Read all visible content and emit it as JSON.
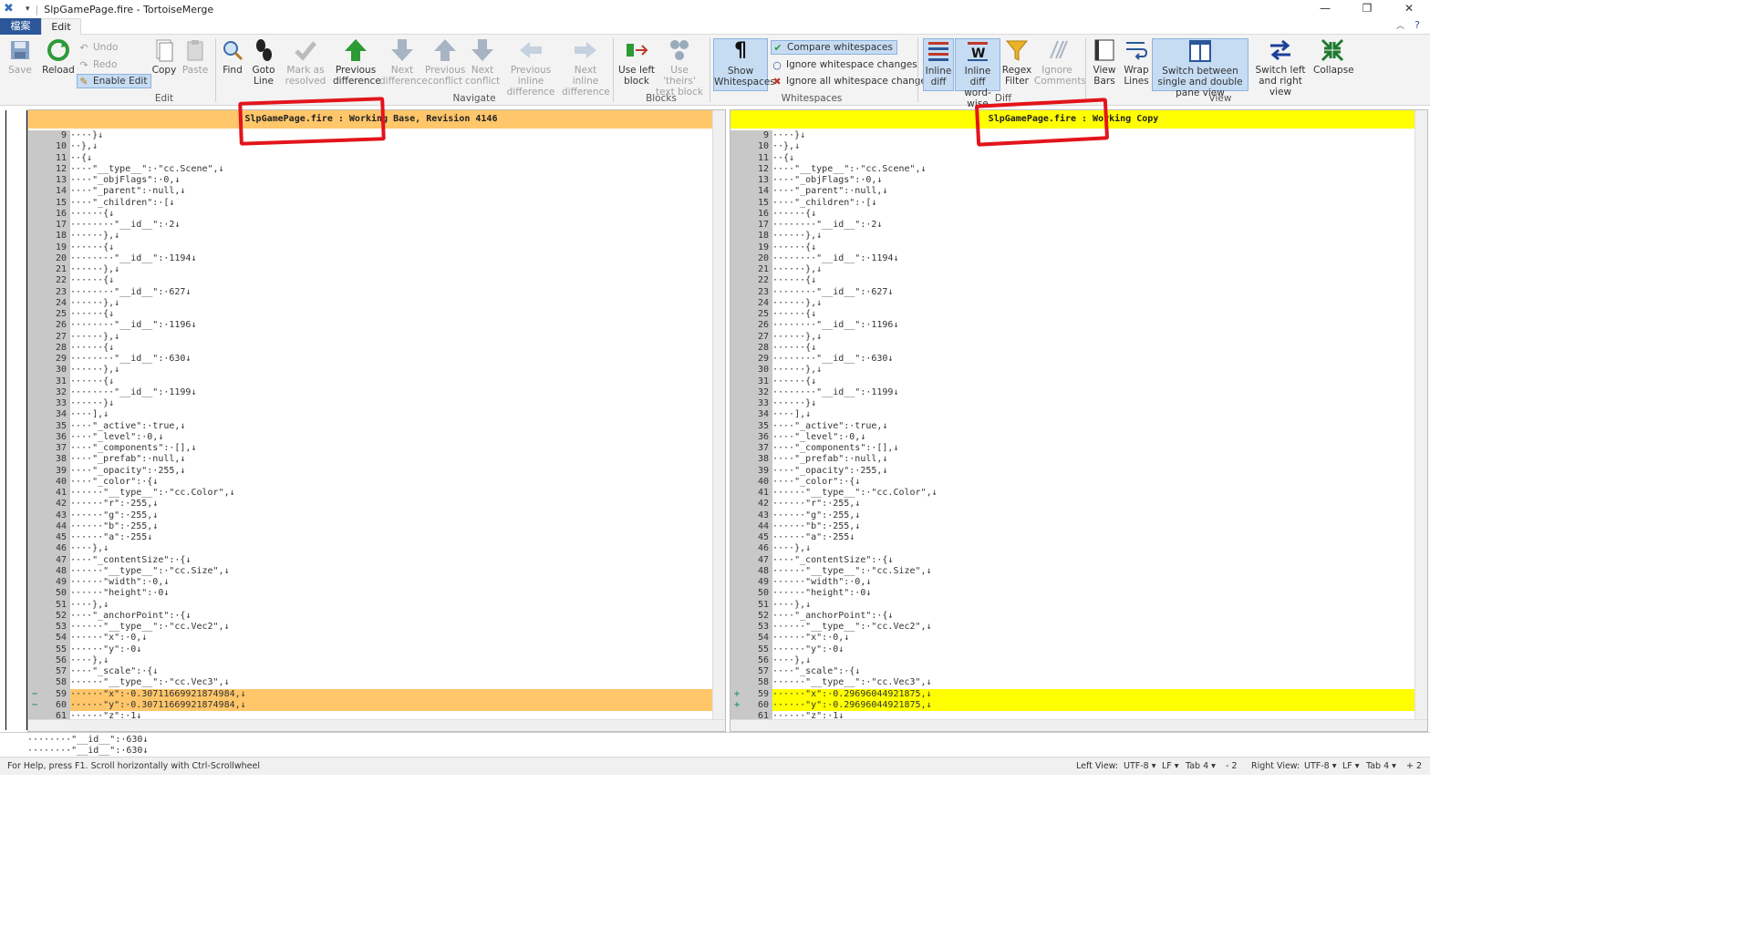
{
  "window": {
    "title": "SlpGamePage.fire - TortoiseMerge",
    "min": "—",
    "max": "❐",
    "close": "✕"
  },
  "tabs": {
    "file": "檔案",
    "edit": "Edit"
  },
  "ribbon": {
    "save": "Save",
    "reload": "Reload",
    "undo": "Undo",
    "redo": "Redo",
    "enable_edit": "Enable Edit",
    "copy": "Copy",
    "paste": "Paste",
    "find": "Find",
    "goto_line": "Goto Line",
    "mark_resolved": "Mark as resolved",
    "prev_diff": "Previous difference",
    "next_diff": "Next difference",
    "prev_conflict": "Previous conflict",
    "next_conflict": "Next conflict",
    "prev_inline": "Previous inline difference",
    "next_inline": "Next inline difference",
    "use_left": "Use left block",
    "use_theirs": "Use 'theirs' text block",
    "show_ws": "Show Whitespaces",
    "compare_ws": "Compare whitespaces",
    "ignore_ws_changes": "Ignore whitespace changes",
    "ignore_all_ws": "Ignore all whitespace changes",
    "inline_diff": "Inline diff",
    "inline_word": "Inline diff word-wise",
    "regex_filter": "Regex Filter",
    "ignore_comments": "Ignore Comments",
    "view_bars": "View Bars",
    "wrap_lines": "Wrap Lines",
    "switch_single_double": "Switch between single and double pane view",
    "switch_left_right": "Switch left and right view",
    "collapse": "Collapse",
    "groups": {
      "edit": "Edit",
      "navigate": "Navigate",
      "blocks": "Blocks",
      "whitespaces": "Whitespaces",
      "diff": "Diff",
      "view": "View"
    }
  },
  "left_pane": {
    "header": "SlpGamePage.fire : Working Base, Revision 4146",
    "header_color": "#ffc66a",
    "changed_color": "#ffc66a",
    "lines": [
      {
        "n": "9",
        "t": "····}↓"
      },
      {
        "n": "10",
        "t": "··},↓"
      },
      {
        "n": "11",
        "t": "··{↓"
      },
      {
        "n": "12",
        "t": "····\"__type__\":·\"cc.Scene\",↓"
      },
      {
        "n": "13",
        "t": "····\"_objFlags\":·0,↓"
      },
      {
        "n": "14",
        "t": "····\"_parent\":·null,↓"
      },
      {
        "n": "15",
        "t": "····\"_children\":·[↓"
      },
      {
        "n": "16",
        "t": "······{↓"
      },
      {
        "n": "17",
        "t": "········\"__id__\":·2↓"
      },
      {
        "n": "18",
        "t": "······},↓"
      },
      {
        "n": "19",
        "t": "······{↓"
      },
      {
        "n": "20",
        "t": "········\"__id__\":·1194↓"
      },
      {
        "n": "21",
        "t": "······},↓"
      },
      {
        "n": "22",
        "t": "······{↓"
      },
      {
        "n": "23",
        "t": "········\"__id__\":·627↓"
      },
      {
        "n": "24",
        "t": "······},↓"
      },
      {
        "n": "25",
        "t": "······{↓"
      },
      {
        "n": "26",
        "t": "········\"__id__\":·1196↓"
      },
      {
        "n": "27",
        "t": "······},↓"
      },
      {
        "n": "28",
        "t": "······{↓"
      },
      {
        "n": "29",
        "t": "········\"__id__\":·630↓"
      },
      {
        "n": "30",
        "t": "······},↓"
      },
      {
        "n": "31",
        "t": "······{↓"
      },
      {
        "n": "32",
        "t": "········\"__id__\":·1199↓"
      },
      {
        "n": "33",
        "t": "······}↓"
      },
      {
        "n": "34",
        "t": "····],↓"
      },
      {
        "n": "35",
        "t": "····\"_active\":·true,↓"
      },
      {
        "n": "36",
        "t": "····\"_level\":·0,↓"
      },
      {
        "n": "37",
        "t": "····\"_components\":·[],↓"
      },
      {
        "n": "38",
        "t": "····\"_prefab\":·null,↓"
      },
      {
        "n": "39",
        "t": "····\"_opacity\":·255,↓"
      },
      {
        "n": "40",
        "t": "····\"_color\":·{↓"
      },
      {
        "n": "41",
        "t": "······\"__type__\":·\"cc.Color\",↓"
      },
      {
        "n": "42",
        "t": "······\"r\":·255,↓"
      },
      {
        "n": "43",
        "t": "······\"g\":·255,↓"
      },
      {
        "n": "44",
        "t": "······\"b\":·255,↓"
      },
      {
        "n": "45",
        "t": "······\"a\":·255↓"
      },
      {
        "n": "46",
        "t": "····},↓"
      },
      {
        "n": "47",
        "t": "····\"_contentSize\":·{↓"
      },
      {
        "n": "48",
        "t": "······\"__type__\":·\"cc.Size\",↓"
      },
      {
        "n": "49",
        "t": "······\"width\":·0,↓"
      },
      {
        "n": "50",
        "t": "······\"height\":·0↓"
      },
      {
        "n": "51",
        "t": "····},↓"
      },
      {
        "n": "52",
        "t": "····\"_anchorPoint\":·{↓"
      },
      {
        "n": "53",
        "t": "······\"__type__\":·\"cc.Vec2\",↓"
      },
      {
        "n": "54",
        "t": "······\"x\":·0,↓"
      },
      {
        "n": "55",
        "t": "······\"y\":·0↓"
      },
      {
        "n": "56",
        "t": "····},↓"
      },
      {
        "n": "57",
        "t": "····\"_scale\":·{↓"
      },
      {
        "n": "58",
        "t": "······\"__type__\":·\"cc.Vec3\",↓"
      },
      {
        "n": "59",
        "t": "······\"x\":·0.30711669921874984,↓",
        "changed": true,
        "mark": "−"
      },
      {
        "n": "60",
        "t": "······\"y\":·0.30711669921874984,↓",
        "changed": true,
        "mark": "−"
      },
      {
        "n": "61",
        "t": "······\"z\":·1↓"
      }
    ]
  },
  "right_pane": {
    "header": "SlpGamePage.fire : Working Copy",
    "header_color": "#ffff00",
    "changed_color": "#ffff00",
    "lines": [
      {
        "n": "9",
        "t": "····}↓"
      },
      {
        "n": "10",
        "t": "··},↓"
      },
      {
        "n": "11",
        "t": "··{↓"
      },
      {
        "n": "12",
        "t": "····\"__type__\":·\"cc.Scene\",↓"
      },
      {
        "n": "13",
        "t": "····\"_objFlags\":·0,↓"
      },
      {
        "n": "14",
        "t": "····\"_parent\":·null,↓"
      },
      {
        "n": "15",
        "t": "····\"_children\":·[↓"
      },
      {
        "n": "16",
        "t": "······{↓"
      },
      {
        "n": "17",
        "t": "········\"__id__\":·2↓"
      },
      {
        "n": "18",
        "t": "······},↓"
      },
      {
        "n": "19",
        "t": "······{↓"
      },
      {
        "n": "20",
        "t": "········\"__id__\":·1194↓"
      },
      {
        "n": "21",
        "t": "······},↓"
      },
      {
        "n": "22",
        "t": "······{↓"
      },
      {
        "n": "23",
        "t": "········\"__id__\":·627↓"
      },
      {
        "n": "24",
        "t": "······},↓"
      },
      {
        "n": "25",
        "t": "······{↓"
      },
      {
        "n": "26",
        "t": "········\"__id__\":·1196↓"
      },
      {
        "n": "27",
        "t": "······},↓"
      },
      {
        "n": "28",
        "t": "······{↓"
      },
      {
        "n": "29",
        "t": "········\"__id__\":·630↓"
      },
      {
        "n": "30",
        "t": "······},↓"
      },
      {
        "n": "31",
        "t": "······{↓"
      },
      {
        "n": "32",
        "t": "········\"__id__\":·1199↓"
      },
      {
        "n": "33",
        "t": "······}↓"
      },
      {
        "n": "34",
        "t": "····],↓"
      },
      {
        "n": "35",
        "t": "····\"_active\":·true,↓"
      },
      {
        "n": "36",
        "t": "····\"_level\":·0,↓"
      },
      {
        "n": "37",
        "t": "····\"_components\":·[],↓"
      },
      {
        "n": "38",
        "t": "····\"_prefab\":·null,↓"
      },
      {
        "n": "39",
        "t": "····\"_opacity\":·255,↓"
      },
      {
        "n": "40",
        "t": "····\"_color\":·{↓"
      },
      {
        "n": "41",
        "t": "······\"__type__\":·\"cc.Color\",↓"
      },
      {
        "n": "42",
        "t": "······\"r\":·255,↓"
      },
      {
        "n": "43",
        "t": "······\"g\":·255,↓"
      },
      {
        "n": "44",
        "t": "······\"b\":·255,↓"
      },
      {
        "n": "45",
        "t": "······\"a\":·255↓"
      },
      {
        "n": "46",
        "t": "····},↓"
      },
      {
        "n": "47",
        "t": "····\"_contentSize\":·{↓"
      },
      {
        "n": "48",
        "t": "······\"__type__\":·\"cc.Size\",↓"
      },
      {
        "n": "49",
        "t": "······\"width\":·0,↓"
      },
      {
        "n": "50",
        "t": "······\"height\":·0↓"
      },
      {
        "n": "51",
        "t": "····},↓"
      },
      {
        "n": "52",
        "t": "····\"_anchorPoint\":·{↓"
      },
      {
        "n": "53",
        "t": "······\"__type__\":·\"cc.Vec2\",↓"
      },
      {
        "n": "54",
        "t": "······\"x\":·0,↓"
      },
      {
        "n": "55",
        "t": "······\"y\":·0↓"
      },
      {
        "n": "56",
        "t": "····},↓"
      },
      {
        "n": "57",
        "t": "····\"_scale\":·{↓"
      },
      {
        "n": "58",
        "t": "······\"__type__\":·\"cc.Vec3\",↓"
      },
      {
        "n": "59",
        "t": "······\"x\":·0.29696044921875,↓",
        "changed": true,
        "mark": "+"
      },
      {
        "n": "60",
        "t": "······\"y\":·0.29696044921875,↓",
        "changed": true,
        "mark": "+"
      },
      {
        "n": "61",
        "t": "······\"z\":·1↓"
      }
    ]
  },
  "bottom_pane": {
    "line1": "········\"__id__\":·630↓",
    "line2": "········\"__id__\":·630↓"
  },
  "status": {
    "help": "For Help, press F1. Scroll horizontally with Ctrl-Scrollwheel",
    "left_view": "Left View:",
    "left_enc": "UTF-8 ▾",
    "left_eol": "LF ▾",
    "left_tab": "Tab 4 ▾",
    "left_diff": "- 2",
    "right_view": "Right View:",
    "right_enc": "UTF-8 ▾",
    "right_eol": "LF ▾",
    "right_tab": "Tab 4 ▾",
    "right_diff": "+ 2"
  }
}
